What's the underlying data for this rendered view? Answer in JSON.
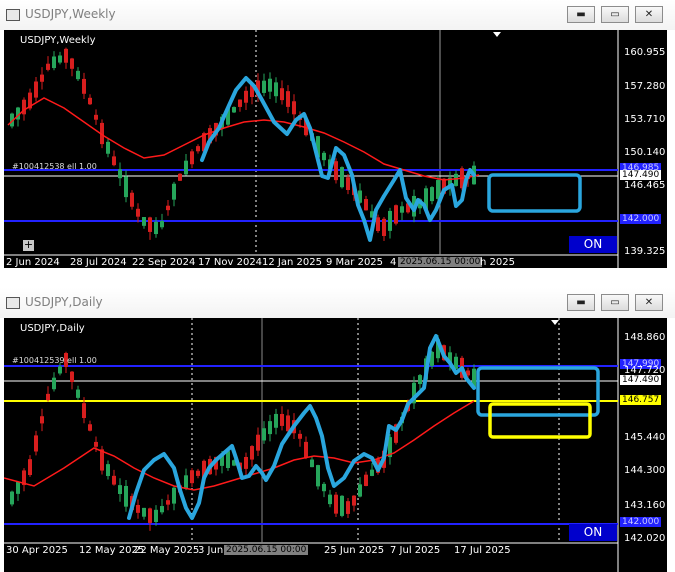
{
  "weekly": {
    "title": "USDJPY,Weekly",
    "chart_label": "USDJPY,Weekly",
    "price_labels": [
      "160.955",
      "157.280",
      "153.710",
      "150.140",
      "146.465",
      "139.325"
    ],
    "overlap_price": "147.490",
    "tag_blue": "146.985",
    "tag_blue_low": "142.000",
    "dates": [
      "2 Jun 2024",
      "28 Jul 2024",
      "22 Sep 2024",
      "17 Nov 2024",
      "12 Jan 2025",
      "9 Mar 2025",
      "4",
      "2025.06.15 00:00",
      "h 2025"
    ],
    "on_label": "ON",
    "overlap_text": "#100412538 ell 1.00",
    "colors": {
      "bg": "#000000",
      "ma": "#ff0000",
      "level": "#0000ff",
      "drawing": "#29a9e1",
      "box": "#29a9e1"
    }
  },
  "daily": {
    "title": "USDJPY,Daily",
    "chart_label": "USDJPY,Daily",
    "price_labels": [
      "148.860",
      "147.720",
      "147.490",
      "146.757",
      "145.440",
      "144.300",
      "143.160",
      "142.020"
    ],
    "tag_top": "147.990",
    "tag_bottom": "142.000",
    "dates": [
      "30 Apr 2025",
      "12 May 2025",
      "22 May 2025",
      "3 Jun",
      "2025.06.15 00:00",
      "25 Jun 2025",
      "7 Jul 2025",
      "17 Jul 2025"
    ],
    "on_label": "ON",
    "overlap_text": "#100412539 ell 1.00",
    "colors": {
      "bg": "#000000",
      "ma": "#ff0000",
      "level": "#0000ff",
      "yellow": "#ffff00",
      "drawing": "#29a9e1"
    }
  },
  "window_buttons": {
    "min": "▬",
    "max": "▭",
    "close": "✕"
  }
}
